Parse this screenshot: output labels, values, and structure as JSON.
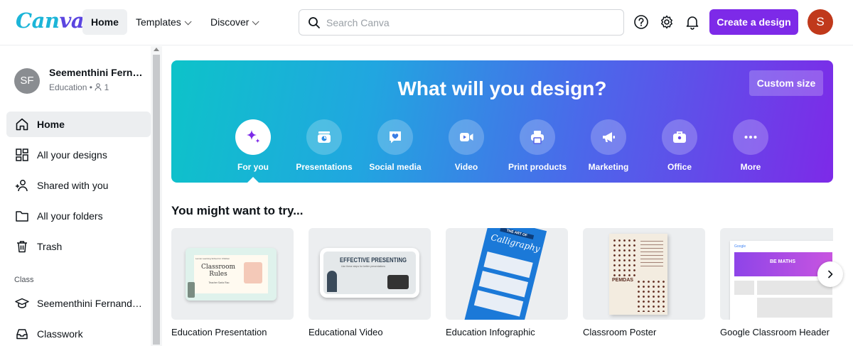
{
  "header": {
    "logo": "Canva",
    "nav": [
      {
        "label": "Home"
      },
      {
        "label": "Templates"
      },
      {
        "label": "Discover"
      }
    ],
    "search_placeholder": "Search Canva",
    "create_label": "Create a design",
    "user_initial": "S",
    "accent_color": "#7d2ae8",
    "icons": [
      "help-icon",
      "settings-icon",
      "bell-icon"
    ]
  },
  "sidebar": {
    "profile": {
      "initials": "SF",
      "name": "Seementhini Fernandes",
      "team": "Education",
      "members": "1"
    },
    "items": [
      {
        "label": "Home",
        "icon": "home-icon"
      },
      {
        "label": "All your designs",
        "icon": "grid-icon"
      },
      {
        "label": "Shared with you",
        "icon": "shared-icon"
      },
      {
        "label": "All your folders",
        "icon": "folder-icon"
      },
      {
        "label": "Trash",
        "icon": "trash-icon"
      }
    ],
    "class_heading": "Class",
    "class_items": [
      {
        "label": "Seementhini Fernandes's Class",
        "icon": "graduation-cap-icon"
      },
      {
        "label": "Classwork",
        "icon": "inbox-icon"
      }
    ]
  },
  "hero": {
    "title": "What will you design?",
    "custom_size": "Custom size",
    "categories": [
      {
        "label": "For you",
        "icon": "sparkle-icon"
      },
      {
        "label": "Presentations",
        "icon": "presentation-icon"
      },
      {
        "label": "Social media",
        "icon": "heart-chat-icon"
      },
      {
        "label": "Video",
        "icon": "video-icon"
      },
      {
        "label": "Print products",
        "icon": "printer-icon"
      },
      {
        "label": "Marketing",
        "icon": "megaphone-icon"
      },
      {
        "label": "Office",
        "icon": "briefcase-icon"
      },
      {
        "label": "More",
        "icon": "more-icon"
      }
    ]
  },
  "suggestions": {
    "title": "You might want to try...",
    "cards": [
      {
        "title": "Education Presentation",
        "thumb_text": "Classroom Rules",
        "thumb_sub": "Teacher Sarla Rao",
        "thumb_caption": "Lemon Learning School for Children"
      },
      {
        "title": "Educational Video",
        "thumb_text": "EFFECTIVE PRESENTING",
        "thumb_sub": "Use these steps for better presentations"
      },
      {
        "title": "Education Infographic",
        "thumb_text": "THE ART OF",
        "thumb_sub": "Calligraphy"
      },
      {
        "title": "Classroom Poster",
        "thumb_text": "PEMDAS"
      },
      {
        "title": "Google Classroom Header",
        "thumb_text": "BE MATHS",
        "thumb_sub": "Google"
      }
    ]
  }
}
